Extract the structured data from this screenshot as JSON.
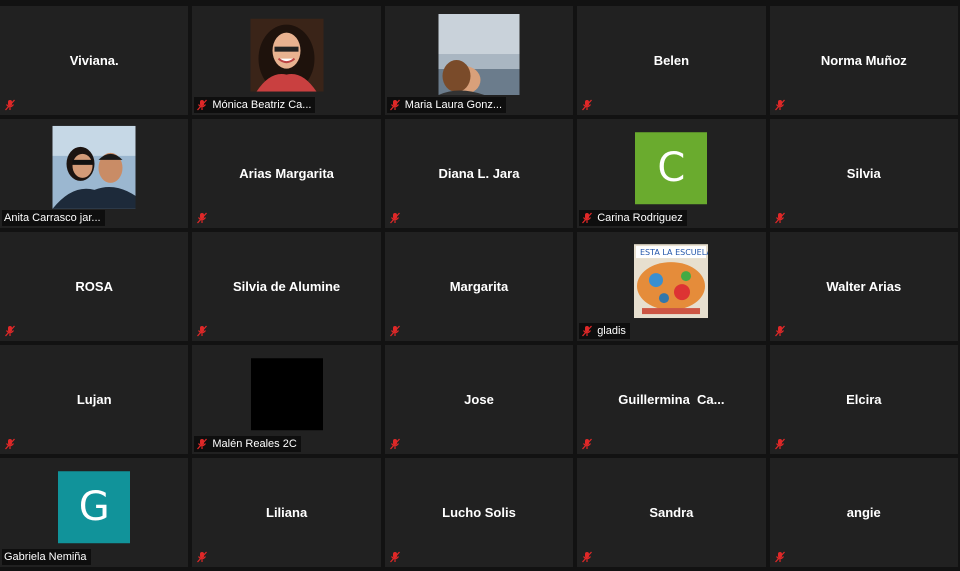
{
  "participants": [
    {
      "name": "Viviana.",
      "video": "none"
    },
    {
      "name": "Mónica Beatriz Ca...",
      "video": "photo-woman-dark-hair"
    },
    {
      "name": "Maria Laura Gonz...",
      "video": "photo-woman-sky"
    },
    {
      "name": "Belen",
      "video": "none"
    },
    {
      "name": "Norma Muñoz",
      "video": "none"
    },
    {
      "name": "Anita Carrasco jar...",
      "video": "photo-couple"
    },
    {
      "name": "Arias Margarita",
      "video": "none"
    },
    {
      "name": "Diana L. Jara",
      "video": "none"
    },
    {
      "name": "Carina Rodriguez",
      "video": "letter",
      "letter": "C",
      "color": "#6aab2e"
    },
    {
      "name": "Silvia",
      "video": "none"
    },
    {
      "name": "ROSA",
      "video": "none"
    },
    {
      "name": "Silvia de Alumine",
      "video": "none"
    },
    {
      "name": "Margarita",
      "video": "none"
    },
    {
      "name": "gladis",
      "video": "photo-drawing"
    },
    {
      "name": "Walter Arias",
      "video": "none"
    },
    {
      "name": "Lujan",
      "video": "none"
    },
    {
      "name": "Malén Reales 2C",
      "video": "black"
    },
    {
      "name": "Jose",
      "video": "none"
    },
    {
      "name": "Guillermina  Ca...",
      "video": "none"
    },
    {
      "name": "Elcira",
      "video": "none"
    },
    {
      "name": "Gabriela Nemiña",
      "video": "letter",
      "letter": "G",
      "color": "#11939a"
    },
    {
      "name": "Liliana",
      "video": "none"
    },
    {
      "name": "Lucho Solis",
      "video": "none"
    },
    {
      "name": "Sandra",
      "video": "none"
    },
    {
      "name": "angie",
      "video": "none"
    }
  ],
  "colors": {
    "background": "#121212",
    "tile": "#212121",
    "muted_icon": "#e02828"
  }
}
